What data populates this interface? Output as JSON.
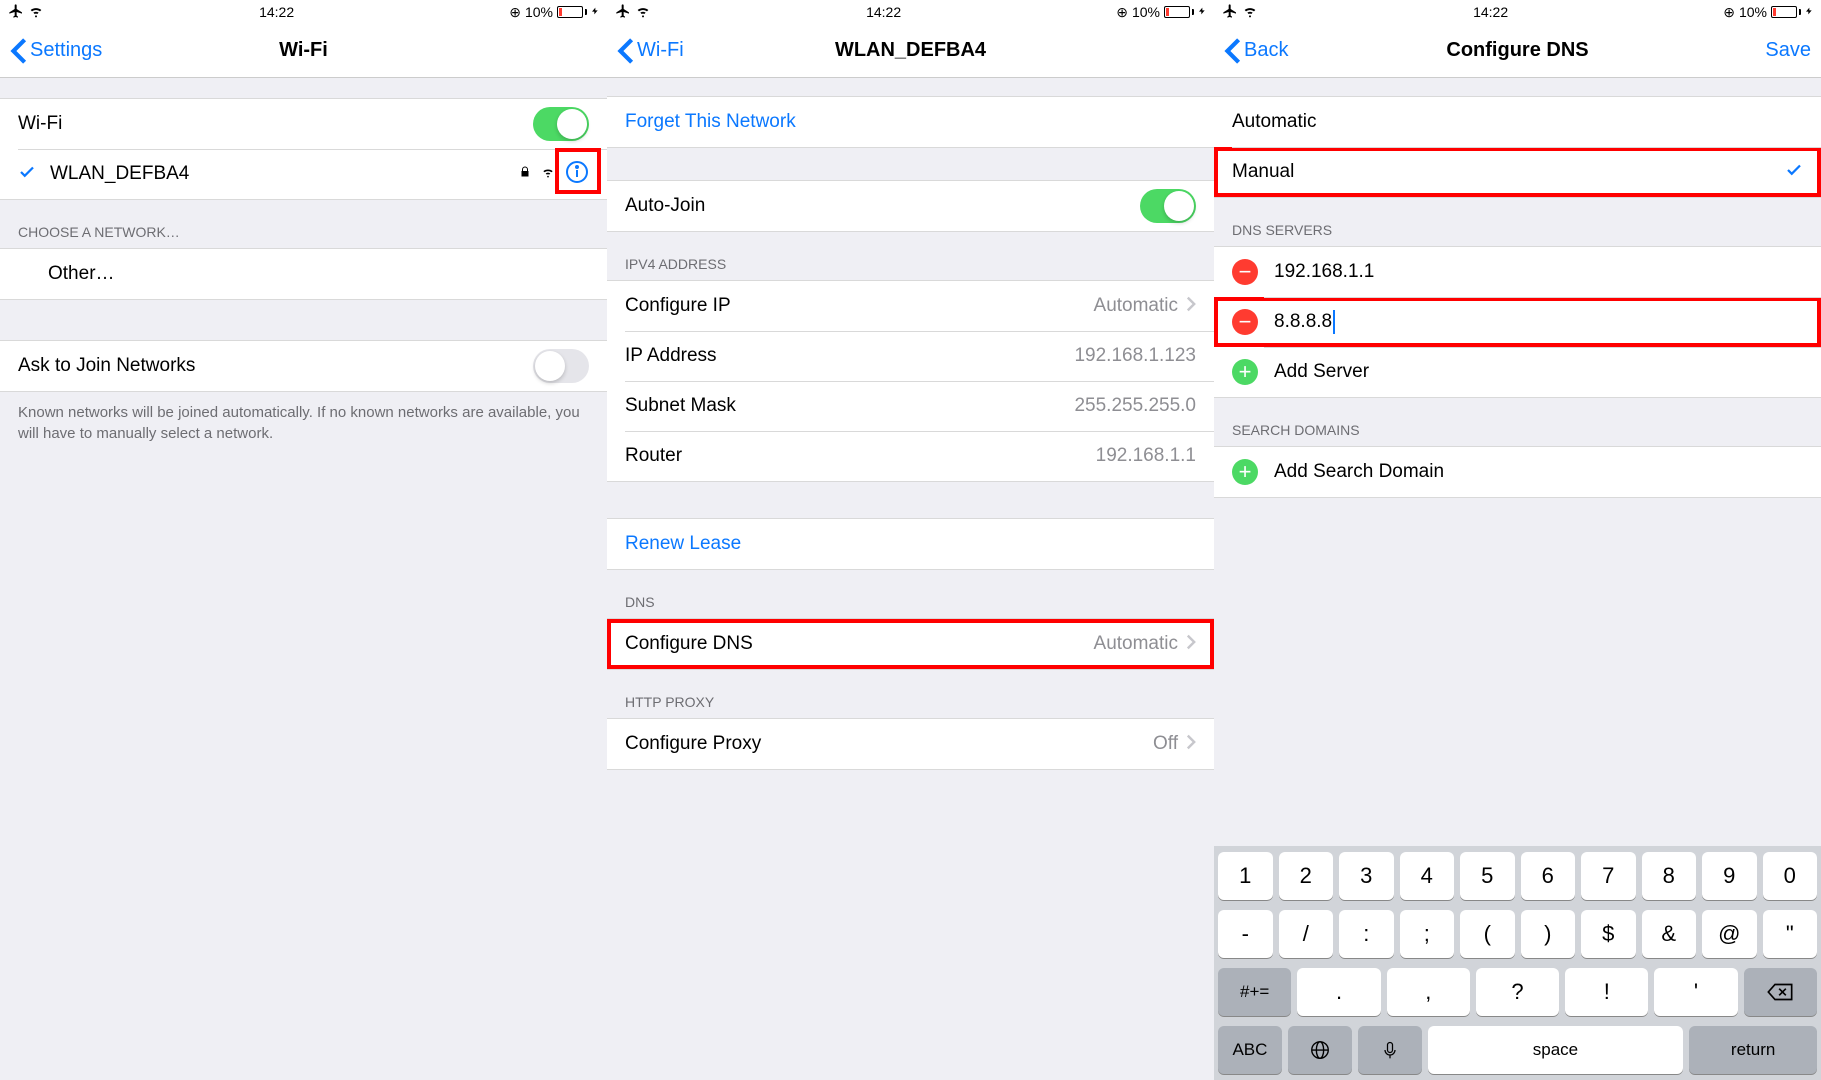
{
  "status": {
    "time": "14:22",
    "batteryPct": "10%"
  },
  "screen1": {
    "back": "Settings",
    "title": "Wi-Fi",
    "wifiLabel": "Wi-Fi",
    "network": "WLAN_DEFBA4",
    "chooseHeader": "CHOOSE A NETWORK…",
    "other": "Other…",
    "askLabel": "Ask to Join Networks",
    "askNote": "Known networks will be joined automatically. If no known networks are available, you will have to manually select a network."
  },
  "screen2": {
    "back": "Wi-Fi",
    "title": "WLAN_DEFBA4",
    "forget": "Forget This Network",
    "autoJoin": "Auto-Join",
    "ipv4Header": "IPV4 ADDRESS",
    "configIpLabel": "Configure IP",
    "configIpValue": "Automatic",
    "ipLabel": "IP Address",
    "ipValue": "192.168.1.123",
    "subnetLabel": "Subnet Mask",
    "subnetValue": "255.255.255.0",
    "routerLabel": "Router",
    "routerValue": "192.168.1.1",
    "renew": "Renew Lease",
    "dnsHeader": "DNS",
    "configDnsLabel": "Configure DNS",
    "configDnsValue": "Automatic",
    "proxyHeader": "HTTP PROXY",
    "configProxyLabel": "Configure Proxy",
    "configProxyValue": "Off"
  },
  "screen3": {
    "back": "Back",
    "title": "Configure DNS",
    "save": "Save",
    "automatic": "Automatic",
    "manual": "Manual",
    "dnsServersHeader": "DNS SERVERS",
    "server1": "192.168.1.1",
    "server2": "8.8.8.8",
    "addServer": "Add Server",
    "searchDomainsHeader": "SEARCH DOMAINS",
    "addSearchDomain": "Add Search Domain"
  },
  "keyboard": {
    "row1": [
      "1",
      "2",
      "3",
      "4",
      "5",
      "6",
      "7",
      "8",
      "9",
      "0"
    ],
    "row2": [
      "-",
      "/",
      ":",
      ";",
      "(",
      ")",
      "$",
      "&",
      "@",
      "\""
    ],
    "modPunc": "#+=",
    "row3": [
      ".",
      ",",
      "?",
      "!",
      "'"
    ],
    "modAbc": "ABC",
    "space": "space",
    "return": "return"
  }
}
